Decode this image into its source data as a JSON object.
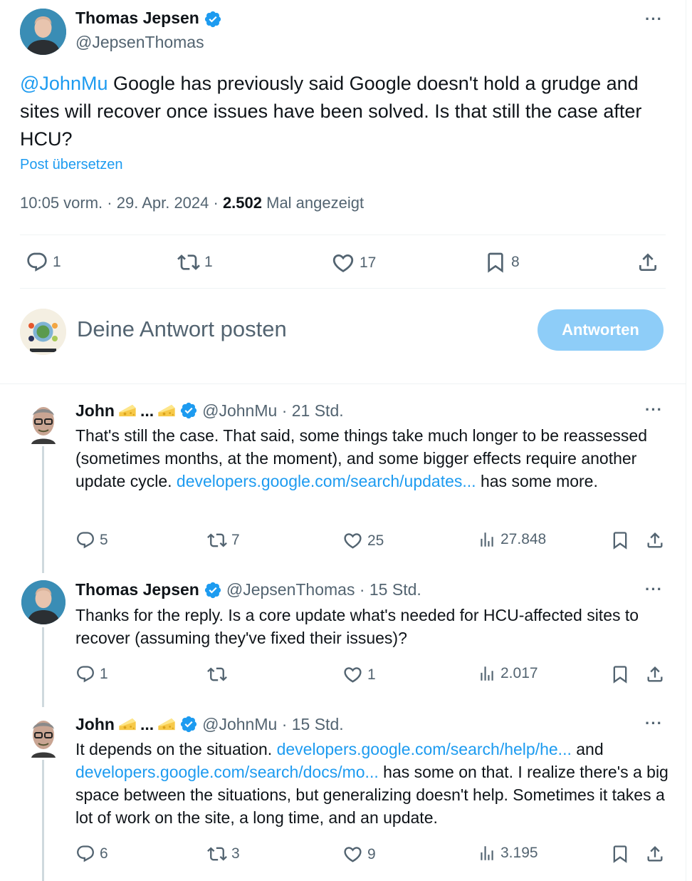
{
  "main": {
    "name": "Thomas Jepsen",
    "handle": "@JepsenThomas",
    "mention": "@JohnMu",
    "text": " Google has previously said Google doesn't hold a grudge and sites will recover once issues have been solved. Is that still the case after HCU?",
    "translate": "Post übersetzen",
    "time": "10:05 vorm. · 29. Apr. 2024 · ",
    "views": "2.502",
    "views_label": " Mal angezeigt",
    "replies": "1",
    "reposts": "1",
    "likes": "17",
    "bookmarks": "8"
  },
  "compose": {
    "placeholder": "Deine Antwort posten",
    "button": "Antworten"
  },
  "replies": [
    {
      "name": "John",
      "sep": "...",
      "handle": "@JohnMu · 21 Std.",
      "text1": "That's still the case. That said, some things take much longer to be reassessed (sometimes months, at the moment), and some bigger effects require another update cycle. ",
      "link1": "developers.google.com/search/updates...",
      "text2": " has some more.",
      "replies": "5",
      "reposts": "7",
      "likes": "25",
      "views": "27.848"
    },
    {
      "name": "Thomas Jepsen",
      "handle": "@JepsenThomas · 15 Std.",
      "text1": "Thanks for the reply. Is a core update what's needed for HCU-affected sites to recover (assuming they've fixed their issues)?",
      "replies": "1",
      "reposts": "",
      "likes": "1",
      "views": "2.017"
    },
    {
      "name": "John",
      "sep": "...",
      "handle": "@JohnMu · 15 Std.",
      "text1": "It depends on the situation. ",
      "link1": "developers.google.com/search/help/he...",
      "text2": " and ",
      "link2": "developers.google.com/search/docs/mo...",
      "text3": " has some on that. I realize there's a big space between the situations, but generalizing doesn't help. Sometimes it takes a lot of work on the site, a long time, and an update.",
      "replies": "6",
      "reposts": "3",
      "likes": "9",
      "views": "3.195"
    }
  ],
  "colors": {
    "accent": "#1d9bf0",
    "muted": "#536471",
    "button_disabled": "#8ecdf8"
  }
}
